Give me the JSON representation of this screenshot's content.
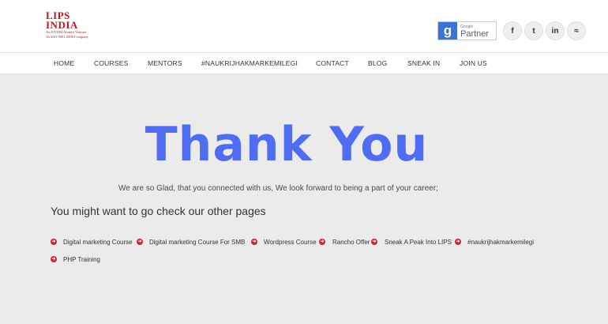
{
  "header": {
    "logo": {
      "title_line1": "LIPS",
      "title_line2": "INDIA",
      "subtitle_line1": "An IIT/IIM Alumni Venture",
      "subtitle_line2": "An ISO 9001:2008 Company"
    },
    "google_partner": {
      "g_letter": "g",
      "small_label": "Google",
      "label": "Partner"
    },
    "social": [
      {
        "icon": "facebook-icon",
        "glyph": "f"
      },
      {
        "icon": "twitter-icon",
        "glyph": "t"
      },
      {
        "icon": "linkedin-icon",
        "glyph": "in"
      },
      {
        "icon": "rss-icon",
        "glyph": "≈"
      }
    ]
  },
  "nav": {
    "items": [
      "HOME",
      "COURSES",
      "MENTORS",
      "#NAUKRIJHAKMARKEMILEGI",
      "CONTACT",
      "BLOG",
      "SNEAK IN",
      "JOIN US"
    ]
  },
  "main": {
    "heading": "Thank You",
    "message": "We are so Glad, that you connected with us, We look forward to being a part of your career;",
    "other_pages_heading": "You might want to go check our other pages",
    "links": [
      "Digital marketing Course",
      "Digital marketing Course For SMB",
      "Wordpress Course",
      "Rancho Offer",
      "Sneak A Peak Into LIPS",
      "#naukrijhakmarkemilegi",
      "PHP Training"
    ],
    "accent_color": "#4f6cf5",
    "bullet_color": "#d92027"
  }
}
